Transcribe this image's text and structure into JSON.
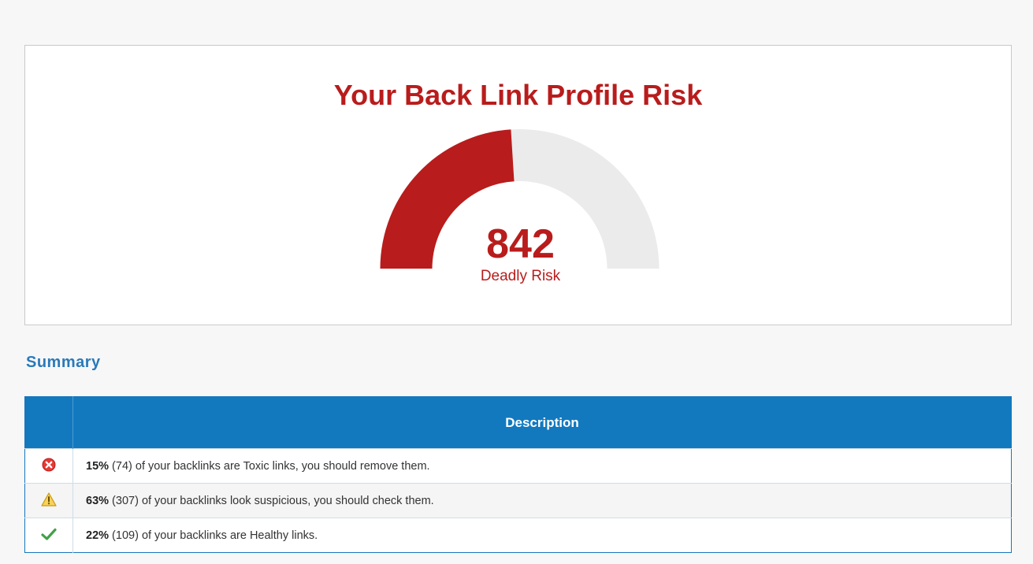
{
  "risk_panel": {
    "title": "Your Back Link Profile Risk",
    "score": "842",
    "score_label": "Deadly Risk",
    "gauge_fill_fraction": 0.48,
    "colors": {
      "fill": "#b91c1c",
      "track": "#ebebeb"
    }
  },
  "summary": {
    "heading": "Summary",
    "table_header": {
      "icon_col": "",
      "description": "Description"
    },
    "rows": [
      {
        "icon": "error-icon",
        "percent": "15%",
        "text": " (74) of your backlinks are Toxic links, you should remove them."
      },
      {
        "icon": "warning-icon",
        "percent": "63%",
        "text": " (307) of your backlinks look suspicious, you should check them."
      },
      {
        "icon": "check-icon",
        "percent": "22%",
        "text": " (109) of your backlinks are Healthy links."
      }
    ]
  }
}
